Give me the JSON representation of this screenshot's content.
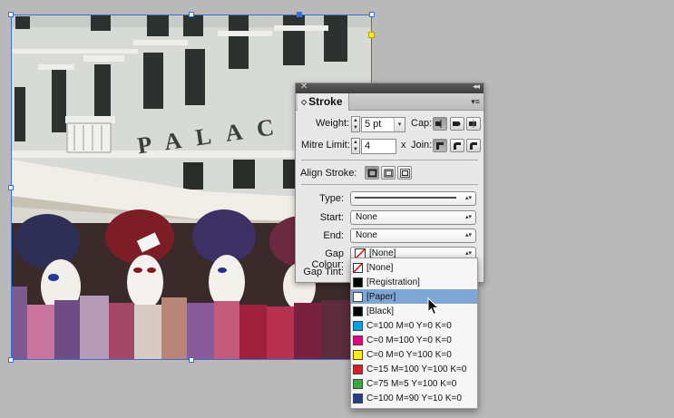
{
  "panel": {
    "title": "Stroke",
    "close_glyph": "✕",
    "collapse_glyph": "◂◂",
    "menu_glyph": "▾≡",
    "weight_label": "Weight:",
    "weight_value": "5 pt",
    "cap_label": "Cap:",
    "mitre_label": "Mitre Limit:",
    "mitre_value": "4",
    "times_label": "x",
    "join_label": "Join:",
    "align_label": "Align Stroke:",
    "type_label": "Type:",
    "start_label": "Start:",
    "start_value": "None",
    "end_label": "End:",
    "end_value": "None",
    "gap_colour_label": "Gap Colour:",
    "gap_colour_value": "[None]",
    "gap_tint_label": "Gap Tint:"
  },
  "dropdown": {
    "items": [
      {
        "label": "[None]",
        "color": "none",
        "selected": false
      },
      {
        "label": "[Registration]",
        "color": "#000000",
        "selected": false
      },
      {
        "label": "[Paper]",
        "color": "#ffffff",
        "selected": true
      },
      {
        "label": "[Black]",
        "color": "#000000",
        "selected": false
      },
      {
        "label": "C=100 M=0 Y=0 K=0",
        "color": "#00a0e4",
        "selected": false
      },
      {
        "label": "C=0 M=100 Y=0 K=0",
        "color": "#e5007d",
        "selected": false
      },
      {
        "label": "C=0 M=0 Y=100 K=0",
        "color": "#fff100",
        "selected": false
      },
      {
        "label": "C=15 M=100 Y=100 K=0",
        "color": "#d2202d",
        "selected": false
      },
      {
        "label": "C=75 M=5 Y=100 K=0",
        "color": "#3aa745",
        "selected": false
      },
      {
        "label": "C=100 M=90 Y=10 K=0",
        "color": "#273a8c",
        "selected": false
      }
    ]
  },
  "photo": {
    "sign_text": "PALAC"
  },
  "colors": {
    "selection_blue": "#3a6fd8",
    "highlight": "#7fa7d6",
    "canvas_bg": "#b9b9b9"
  }
}
